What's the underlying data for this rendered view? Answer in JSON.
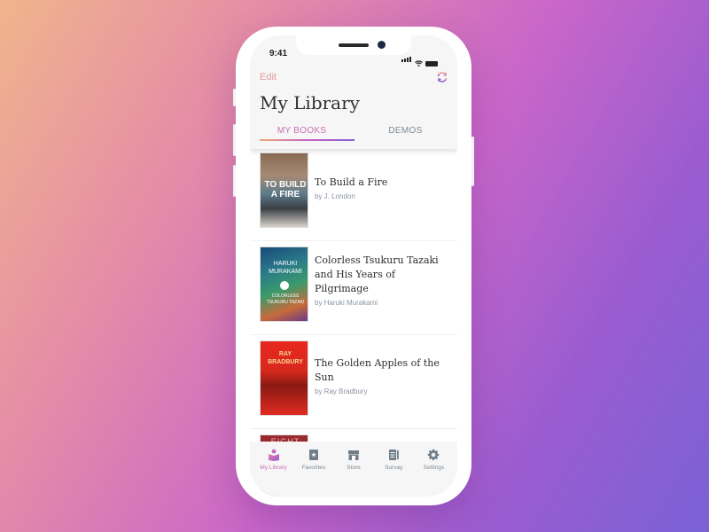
{
  "status_bar": {
    "time": "9:41"
  },
  "header": {
    "edit_label": "Edit",
    "title": "My Library",
    "sync_icon": "sync-icon"
  },
  "tabs": [
    {
      "label": "MY BOOKS",
      "active": true
    },
    {
      "label": "DEMOS",
      "active": false
    }
  ],
  "books": [
    {
      "title": "To Build a Fire",
      "author": "by J. London",
      "cover_text": "TO BUILD A FIRE"
    },
    {
      "title": "Colorless Tsukuru Tazaki and His Years of Pilgrimage",
      "author": "by Haruki Murakami",
      "cover_text_top": "HARUKI MURAKAMI",
      "cover_text_bottom": "COLORLESS TSUKURU TAZAKI"
    },
    {
      "title": "The Golden Apples of the Sun",
      "author": "by Ray Bradbury",
      "cover_text": "RAY BRADBURY"
    },
    {
      "title": "",
      "author": "",
      "cover_text": "EIGHT"
    }
  ],
  "tabbar": [
    {
      "label": "My Library",
      "icon": "book-reader-icon",
      "active": true
    },
    {
      "label": "Favorites",
      "icon": "bookmark-star-icon",
      "active": false
    },
    {
      "label": "Store",
      "icon": "store-icon",
      "active": false
    },
    {
      "label": "Survay",
      "icon": "survey-icon",
      "active": false
    },
    {
      "label": "Settings",
      "icon": "gear-icon",
      "active": false
    }
  ],
  "colors": {
    "accent": "#c86fb5",
    "edit": "#e49a9a",
    "muted": "#7b8a93"
  }
}
